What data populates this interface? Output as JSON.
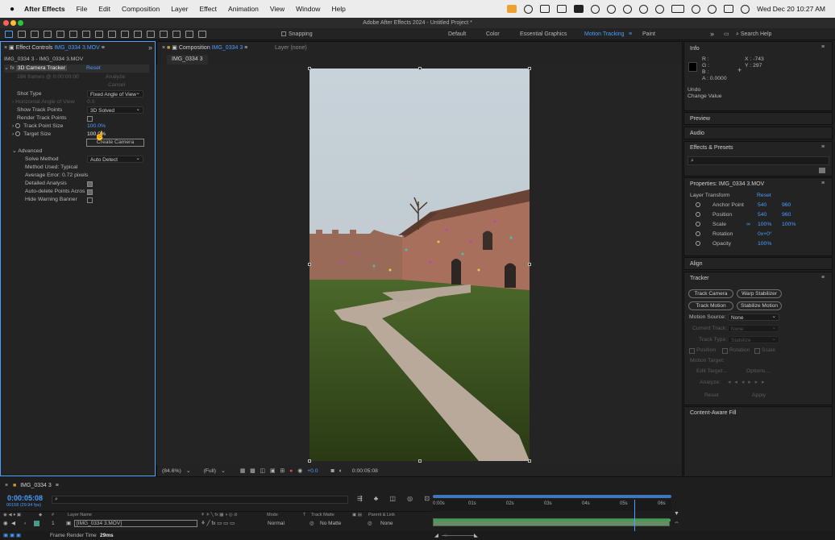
{
  "menubar": {
    "app": "After Effects",
    "items": [
      "File",
      "Edit",
      "Composition",
      "Layer",
      "Effect",
      "Animation",
      "View",
      "Window",
      "Help"
    ],
    "datetime": "Wed Dec 20  10:27 AM"
  },
  "titlebar": {
    "title": "Adobe After Effects 2024 - Untitled Project *"
  },
  "toolbar": {
    "snapping": "Snapping",
    "workspaces": [
      "Default",
      "Color",
      "Essential Graphics",
      "Motion Tracking",
      "Paint"
    ],
    "active_workspace": "Motion Tracking",
    "search_placeholder": "Search Help"
  },
  "effect_controls": {
    "tab_label": "Effect Controls",
    "tab_file": "IMG_0334 3.MOV",
    "layer_path": "IMG_0334 3 - IMG_0334 3.MOV",
    "effect_name": "3D Camera Tracker",
    "reset": "Reset",
    "frames_info": "186 frames @ 0:00:00:00",
    "analyze": "Analyze",
    "cancel": "Cancel",
    "shot_type_label": "Shot Type",
    "shot_type_value": "Fixed Angle of View",
    "hfov_label": "Horizontal Angle of View",
    "hfov_value": "0.0",
    "show_track_points_label": "Show Track Points",
    "show_track_points_value": "3D Solved",
    "render_track_points_label": "Render Track Points",
    "track_point_size_label": "Track Point Size",
    "track_point_size_value": "100.0%",
    "target_size_label": "Target Size",
    "target_size_value": "100.0%",
    "create_camera": "Create Camera",
    "advanced_label": "Advanced",
    "solve_method_label": "Solve Method",
    "solve_method_value": "Auto Detect",
    "method_used": "Method Used: Typical",
    "average_error": "Average Error: 0.72 pixels",
    "detailed_analysis": "Detailed Analysis",
    "auto_delete": "Auto-delete Points Acros",
    "hide_warning": "Hide Warning Banner"
  },
  "composition": {
    "tab_label": "Composition",
    "tab_name": "IMG_0334 3",
    "layer_tab": "Layer (none)",
    "sub_tab": "IMG_0334 3",
    "zoom": "(84.6%)",
    "resolution": "(Full)",
    "exposure": "+0.0",
    "timecode": "0:00:05:08"
  },
  "info": {
    "title": "Info",
    "r": "R :",
    "g": "G :",
    "b": "B :",
    "a": "A : 0.0000",
    "x": "X : -743",
    "y": "Y : 297",
    "undo": "Undo",
    "change_value": "Change Value"
  },
  "panels": {
    "preview": "Preview",
    "audio": "Audio",
    "effects_presets": "Effects & Presets",
    "align": "Align",
    "content_aware_fill": "Content-Aware Fill"
  },
  "properties": {
    "title": "Properties: IMG_0334 3.MOV",
    "layer_transform": "Layer Transform",
    "reset": "Reset",
    "rows": [
      {
        "label": "Anchor Point",
        "v1": "540",
        "v2": "960"
      },
      {
        "label": "Position",
        "v1": "540",
        "v2": "960"
      },
      {
        "label": "Scale",
        "v1": "100%",
        "v2": "100%"
      },
      {
        "label": "Rotation",
        "v1": "0x+0°",
        "v2": ""
      },
      {
        "label": "Opacity",
        "v1": "100%",
        "v2": ""
      }
    ]
  },
  "tracker": {
    "title": "Tracker",
    "track_camera": "Track Camera",
    "warp_stabilizer": "Warp Stabilizer",
    "track_motion": "Track Motion",
    "stabilize_motion": "Stabilize Motion",
    "motion_source_label": "Motion Source:",
    "motion_source_value": "None",
    "current_track_label": "Current Track:",
    "current_track_value": "None",
    "track_type_label": "Track Type:",
    "track_type_value": "Stabilize",
    "position": "Position",
    "rotation": "Rotation",
    "scale": "Scale",
    "motion_target": "Motion Target:",
    "edit_target": "Edit Target...",
    "options": "Options...",
    "analyze": "Analyze:",
    "reset": "Reset",
    "apply": "Apply"
  },
  "timeline": {
    "comp_name": "IMG_0334 3",
    "timecode": "0:00:05:08",
    "frame_info": "00158 (29.94 fps)",
    "layer_name_col": "Layer Name",
    "mode_col": "Mode",
    "t_col": "T",
    "track_matte_col": "Track Matte",
    "parent_col": "Parent & Link",
    "layer_number": "1",
    "layer_name": "[IMG_0334 3.MOV]",
    "layer_mode": "Normal",
    "layer_matte": "No Matte",
    "layer_parent": "None",
    "ruler": [
      "0:00s",
      "01s",
      "02s",
      "03s",
      "04s",
      "05s",
      "06s"
    ],
    "frame_render_label": "Frame Render Time",
    "frame_render_value": "29ms",
    "playhead_fraction": 0.8
  },
  "colors": {
    "accent": "#4a9eff",
    "menubar": "#ececec",
    "panel": "#232323"
  }
}
